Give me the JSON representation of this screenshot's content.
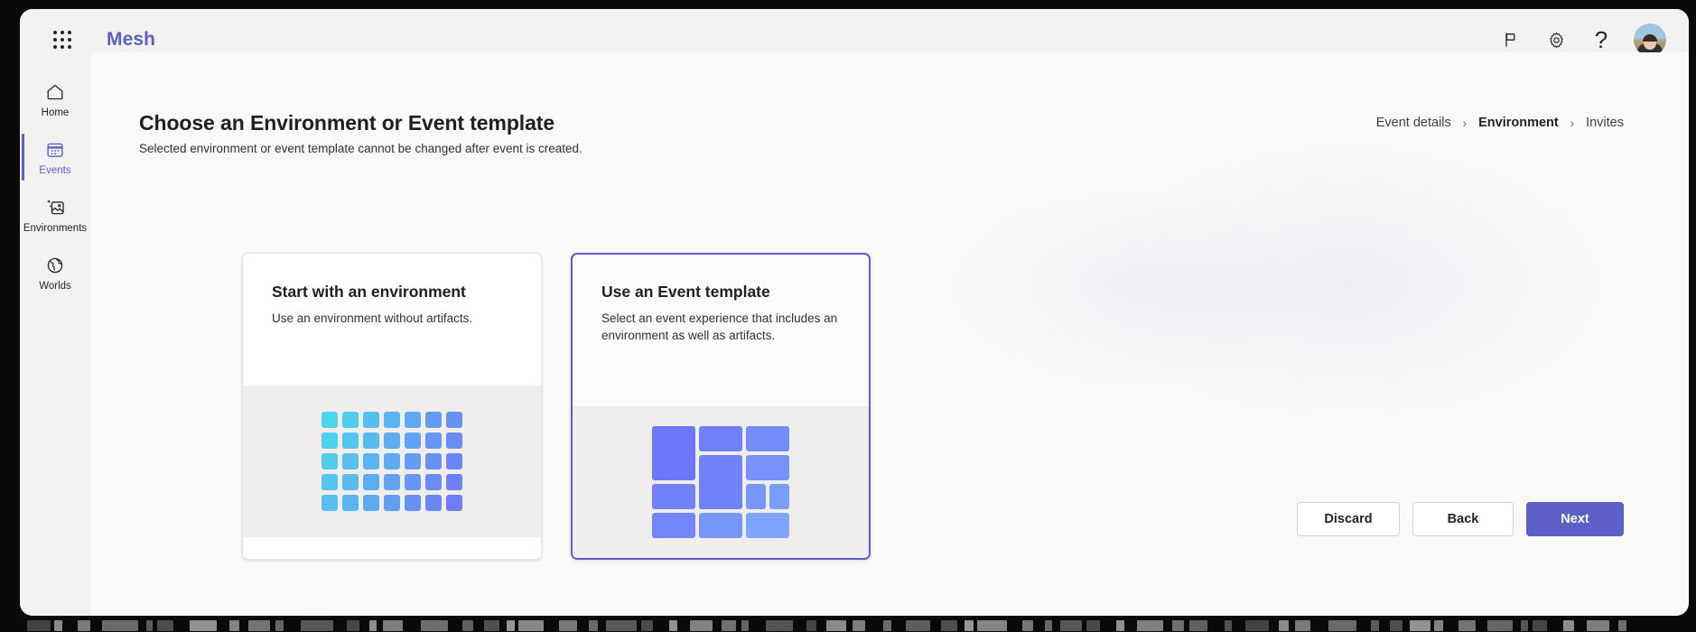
{
  "window": {
    "app_title": "Mesh",
    "brand_color": "#5b5fc7"
  },
  "topbar": {
    "waffle_label": "App launcher",
    "icons": [
      {
        "name": "flag-icon",
        "label": "Report a concern"
      },
      {
        "name": "gear-icon",
        "label": "Settings"
      },
      {
        "name": "help-icon",
        "label": "?"
      }
    ],
    "avatar_label": "Account manager"
  },
  "sidebar": {
    "items": [
      {
        "label": "Home",
        "icon": "home-icon",
        "active": false
      },
      {
        "label": "Events",
        "icon": "calendar-icon",
        "active": true
      },
      {
        "label": "Environments",
        "icon": "image-sparkle-icon",
        "active": false
      },
      {
        "label": "Worlds",
        "icon": "globe-icon",
        "active": false
      }
    ]
  },
  "page": {
    "title": "Choose an Environment or Event template",
    "subtitle": "Selected environment or event template cannot be changed after event is created."
  },
  "breadcrumb": {
    "separator": "›",
    "steps": [
      {
        "label": "Event details",
        "current": false
      },
      {
        "label": "Environment",
        "current": true
      },
      {
        "label": "Invites",
        "current": false
      }
    ]
  },
  "cards": [
    {
      "title": "Start with an environment",
      "description": "Use an environment without artifacts.",
      "selected": false,
      "art": "environment-grid"
    },
    {
      "title": "Use an Event template",
      "description": "Select an event experience that includes an environment as well as artifacts.",
      "selected": true,
      "art": "template-mosaic"
    }
  ],
  "footer": {
    "discard_label": "Discard",
    "back_label": "Back",
    "next_label": "Next"
  },
  "colors": {
    "accent": "#5b5fc7",
    "grid_art_from": "#4ed6ec",
    "grid_art_to": "#6f7bf7",
    "mosaic_from": "#6f7bf7",
    "mosaic_to": "#79a6fb",
    "art_background": "#efeeed",
    "content_background": "#faf9f8",
    "shell_background": "#f3f2f1"
  }
}
